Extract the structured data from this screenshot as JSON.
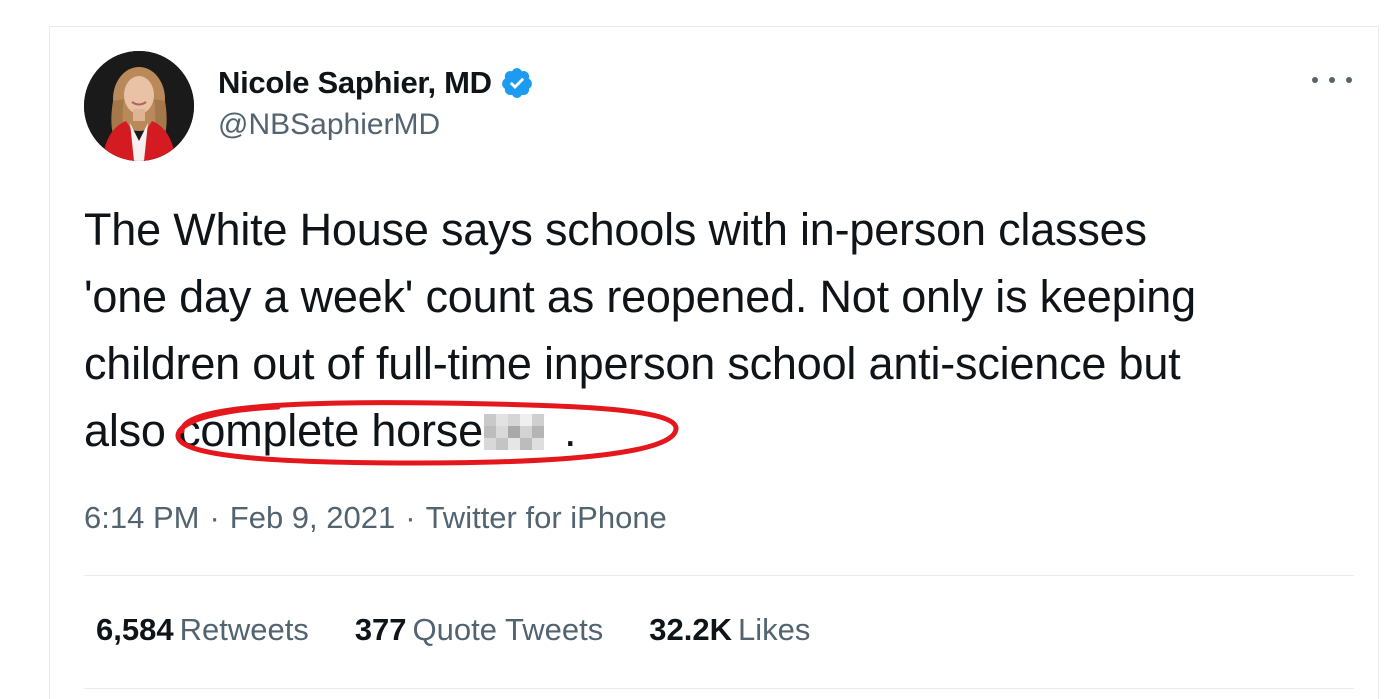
{
  "tweet": {
    "author": {
      "display_name": "Nicole Saphier, MD",
      "handle": "@NBSaphierMD",
      "verified": true,
      "avatar": "avatar-photo"
    },
    "more_icon": "more-horizontal-icon",
    "text_lines": [
      "The White House says schools with in-person classes",
      "'one day a week' count as reopened. Not only is keeping",
      "children out of full-time inperson school anti-science but",
      "also "
    ],
    "highlighted_text": "complete horse",
    "censored_suffix": ".",
    "timestamp": {
      "time": "6:14 PM",
      "separator": "·",
      "date": "Feb 9, 2021",
      "source": "Twitter for iPhone"
    },
    "stats": [
      {
        "count": "6,584",
        "label": "Retweets"
      },
      {
        "count": "377",
        "label": "Quote Tweets"
      },
      {
        "count": "32.2K",
        "label": "Likes"
      }
    ],
    "colors": {
      "verified_blue": "#1d9bf0",
      "secondary_text": "#536471",
      "highlight_red": "#e4171c"
    }
  }
}
